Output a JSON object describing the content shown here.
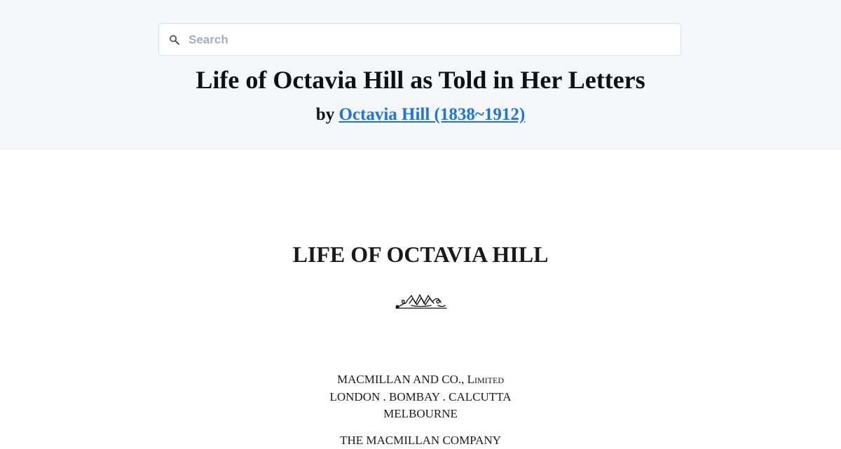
{
  "search": {
    "placeholder": "Search",
    "icon": "search-icon"
  },
  "header": {
    "title": "Life of Octavia Hill as Told in Her Letters",
    "by": "by",
    "author": "Octavia Hill (1838~1912)"
  },
  "content": {
    "title": "LIFE OF OCTAVIA HILL",
    "ornament_icon": "decorative-ornament-icon",
    "publisher_name": "MACMILLAN AND CO., ",
    "publisher_suffix": "Limited",
    "publisher_cities": "LONDON . BOMBAY . CALCUTTA",
    "publisher_city2": "MELBOURNE",
    "next_line": "THE MACMILLAN COMPANY"
  },
  "colors": {
    "link": "#1a73e8",
    "header_bg": "#f5f6f8"
  }
}
